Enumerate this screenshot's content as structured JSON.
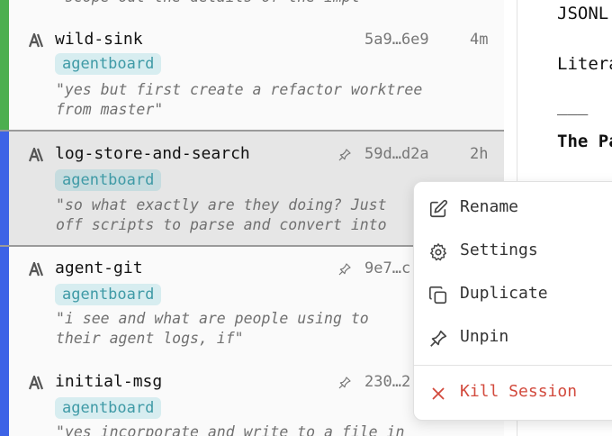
{
  "sessions": [
    {
      "name": "",
      "tag": "",
      "hash": "",
      "age": "",
      "msg1": "\"scope out the details of the impl",
      "msg2": ""
    },
    {
      "name": "wild-sink",
      "tag": "agentboard",
      "hash": "5a9…6e9",
      "age": "4m",
      "msg1": "\"yes but first create a refactor worktree",
      "msg2": "from master\""
    },
    {
      "name": "log-store-and-search",
      "tag": "agentboard",
      "hash": "59d…d2a",
      "age": "2h",
      "msg1": "\"so what exactly are they doing? Just",
      "msg2": "off scripts to parse and convert into"
    },
    {
      "name": "agent-git",
      "tag": "agentboard",
      "hash": "9e7…c",
      "age": "",
      "msg1": "\"i see and what are people using to",
      "msg2": "their agent logs, if\""
    },
    {
      "name": "initial-msg",
      "tag": "agentboard",
      "hash": "230…2",
      "age": "",
      "msg1": "\"yes incorporate and write to a file in",
      "msg2": ""
    }
  ],
  "document": {
    "line1": "JSONL",
    "line2": "Litera",
    "rule": "___",
    "heading": "The Pa"
  },
  "context_menu": {
    "rename": "Rename",
    "settings": "Settings",
    "duplicate": "Duplicate",
    "unpin": "Unpin",
    "kill": "Kill Session"
  },
  "colors": {
    "bar_green": "#4caf50",
    "bar_blue": "#3d63e6",
    "tag_bg": "#d7edf0",
    "tag_text": "#3f9aa6",
    "danger": "#d24a3d"
  },
  "icons": {
    "session_logo": "anthropic-logo-icon",
    "pin": "pin-icon",
    "rename": "edit-icon",
    "settings": "gear-icon",
    "duplicate": "copy-icon",
    "unpin": "pin-icon",
    "kill": "close-icon"
  }
}
